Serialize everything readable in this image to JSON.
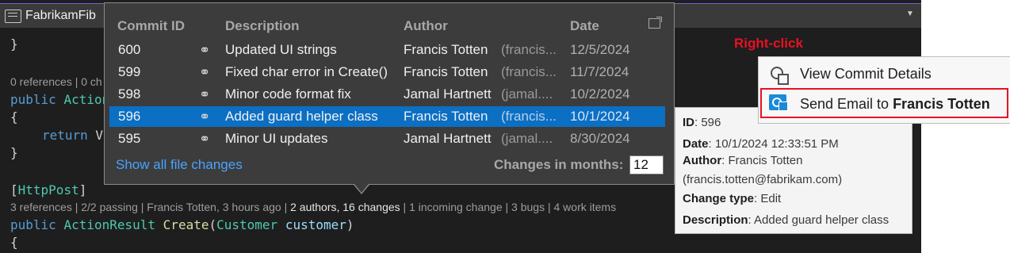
{
  "editor": {
    "tab_title": "FabrikamFib",
    "code": {
      "brace_close": "}",
      "lens_top": "0 references | 0 ch",
      "line_public_action": "public Action",
      "kw_public": "public",
      "type_action": "Action",
      "brace_open": "{",
      "kw_return": "return",
      "return_rest": " V",
      "brace_close2": "}",
      "attribute": "[HttpPost]",
      "attr_name": "HttpPost",
      "lens_bottom": {
        "references": "3 references",
        "passing": "2/2 passing",
        "last_change": "Francis Totten, 3 hours ago",
        "authors_changes": "2 authors, 16 changes",
        "incoming": "1 incoming change",
        "bugs": "3 bugs",
        "work_items": "4 work items"
      },
      "sig_public": "public",
      "sig_type": "ActionResult",
      "sig_fn": "Create",
      "sig_param_type": "Customer",
      "sig_param_name": "customer",
      "brace_open2": "{"
    }
  },
  "popup": {
    "headers": {
      "commit_id": "Commit ID",
      "description": "Description",
      "author": "Author",
      "date": "Date"
    },
    "rows": [
      {
        "id": "600",
        "description": "Updated UI strings",
        "author": "Francis Totten",
        "email": "(francis...",
        "date": "12/5/2024",
        "selected": false
      },
      {
        "id": "599",
        "description": "Fixed char error in Create()",
        "author": "Francis Totten",
        "email": "(francis...",
        "date": "11/7/2024",
        "selected": false
      },
      {
        "id": "598",
        "description": "Minor code format fix",
        "author": "Jamal Hartnett",
        "email": "(jamal....",
        "date": "10/2/2024",
        "selected": false
      },
      {
        "id": "596",
        "description": "Added guard helper class",
        "author": "Francis Totten",
        "email": "(francis...",
        "date": "10/1/2024",
        "selected": true
      },
      {
        "id": "595",
        "description": "Minor UI updates",
        "author": "Jamal Hartnett",
        "email": "(jamal....",
        "date": "8/30/2024",
        "selected": false
      }
    ],
    "show_all": "Show all file changes",
    "months_label": "Changes in months:",
    "months_value": "12"
  },
  "tooltip": {
    "id_label": "ID",
    "id_value": ": 596",
    "date_label": "Date",
    "date_value": ": 10/1/2024 12:33:51 PM",
    "author_label": "Author",
    "author_value": ":  Francis Totten",
    "email": "(francis.totten@fabrikam.com)",
    "change_label": "Change type",
    "change_value": ": Edit",
    "desc_label": "Description",
    "desc_value": ": Added guard helper class"
  },
  "annotation": {
    "right_click": "Right-click"
  },
  "context_menu": {
    "view_details": "View Commit Details",
    "send_email_prefix": "Send Email to ",
    "send_email_name": "Francis Totten"
  },
  "colors": {
    "accent": "#0b6fc4",
    "highlight_border": "#e81123",
    "link": "#4aa3ff"
  }
}
